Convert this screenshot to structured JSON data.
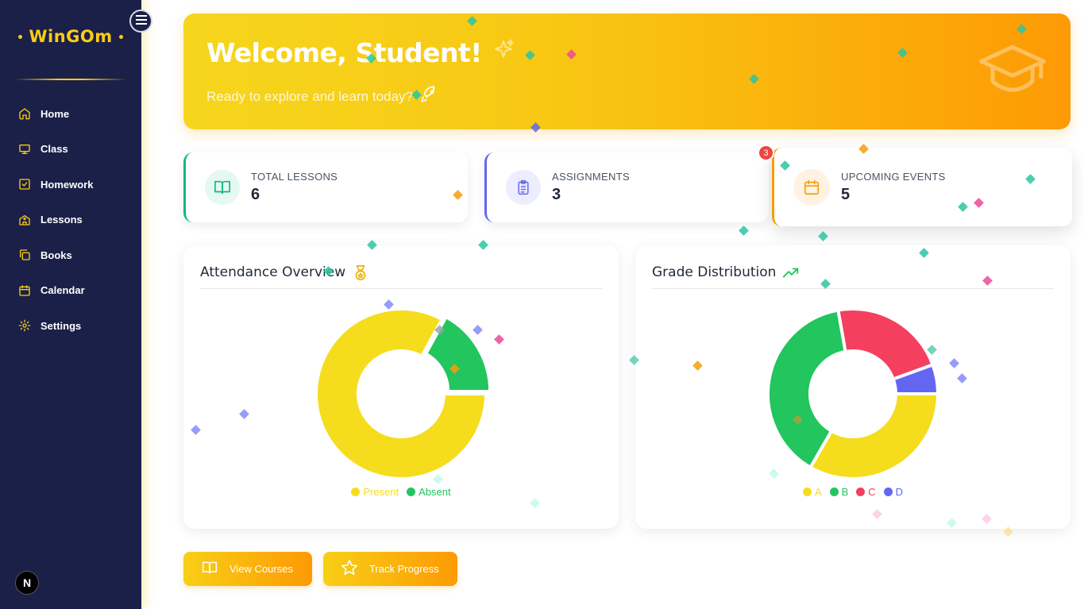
{
  "app": {
    "logo_text": "WinGOm",
    "footer_badge": "N"
  },
  "sidebar": {
    "toggle_icon": "hamburger-menu-icon",
    "items": [
      {
        "label": "Home",
        "icon": "home-icon"
      },
      {
        "label": "Class",
        "icon": "presentation-icon"
      },
      {
        "label": "Homework",
        "icon": "check-square-icon"
      },
      {
        "label": "Lessons",
        "icon": "school-icon"
      },
      {
        "label": "Books",
        "icon": "copy-icon"
      },
      {
        "label": "Calendar",
        "icon": "calendar-icon"
      },
      {
        "label": "Settings",
        "icon": "gear-icon"
      }
    ]
  },
  "hero": {
    "title": "Welcome, Student!",
    "subtitle": "Ready to explore and learn today?",
    "title_icon": "sparkles-icon",
    "subtitle_icon": "rocket-icon",
    "decor_icon": "graduation-cap-icon"
  },
  "stats": [
    {
      "label": "TOTAL LESSONS",
      "value": "6",
      "icon": "book-open-icon",
      "color": "#10b981"
    },
    {
      "label": "ASSIGNMENTS",
      "value": "3",
      "icon": "clipboard-list-icon",
      "color": "#6366f1"
    },
    {
      "label": "UPCOMING EVENTS",
      "value": "5",
      "icon": "calendar-icon",
      "color": "#f59e0b",
      "badge": "3"
    }
  ],
  "charts": {
    "attendance": {
      "title": "Attendance Overview",
      "icon": "medal-icon"
    },
    "grades": {
      "title": "Grade Distribution",
      "icon": "trending-up-icon"
    }
  },
  "chart_data": [
    {
      "type": "pie",
      "title": "Attendance Overview",
      "donut": true,
      "categories": [
        "Present",
        "Absent"
      ],
      "values": [
        83,
        17
      ],
      "colors": [
        "#f5dd1d",
        "#22c55e"
      ],
      "legend": "bottom"
    },
    {
      "type": "pie",
      "title": "Grade Distribution",
      "donut": true,
      "categories": [
        "A",
        "B",
        "C",
        "D"
      ],
      "values": [
        30,
        35,
        20,
        5
      ],
      "colors": [
        "#f5dd1d",
        "#22c55e",
        "#f43f5e",
        "#6366f1"
      ],
      "legend": "bottom"
    }
  ],
  "actions": [
    {
      "label": "View Courses",
      "icon": "book-open-icon"
    },
    {
      "label": "Track Progress",
      "icon": "star-icon"
    }
  ],
  "colors": {
    "sidebar_bg": "#1b2048",
    "accent": "#facc15",
    "hero_start": "#f6d61d",
    "hero_end": "#fd9a05"
  }
}
